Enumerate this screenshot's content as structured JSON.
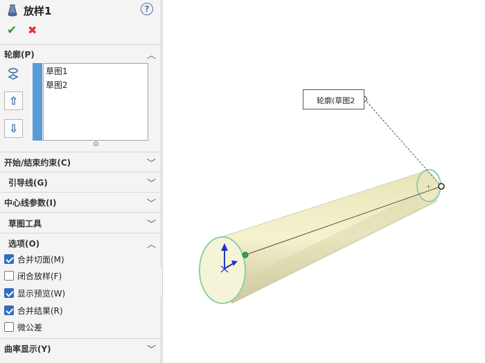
{
  "feature": {
    "title": "放样1",
    "help_label": "?",
    "ok_label": "✔",
    "cancel_label": "✖"
  },
  "profiles": {
    "header": "轮廓(P)",
    "items": [
      "草图1",
      "草图2"
    ],
    "move_up_icon": "arrow-up-icon",
    "move_down_icon": "arrow-down-icon"
  },
  "sections": {
    "start_end": "开始/结束约束(C)",
    "guides": "引导线(G)",
    "centerline": "中心线参数(I)",
    "sketch_tools": "草图工具",
    "options": "选项(O)",
    "curvature": "曲率显示(Y)"
  },
  "options": [
    {
      "label": "合并切面(M)",
      "checked": true
    },
    {
      "label": "闭合放样(F)",
      "checked": false
    },
    {
      "label": "显示预览(W)",
      "checked": true
    },
    {
      "label": "合并结果(R)",
      "checked": true
    },
    {
      "label": "微公差",
      "checked": false
    }
  ],
  "viewport": {
    "callout_label": "轮廓(草图2",
    "colors": {
      "body_fill": "#f1efc6",
      "edge": "#8ccfa8",
      "point_green": "#2fa84f",
      "triad_blue": "#2233cc"
    }
  }
}
